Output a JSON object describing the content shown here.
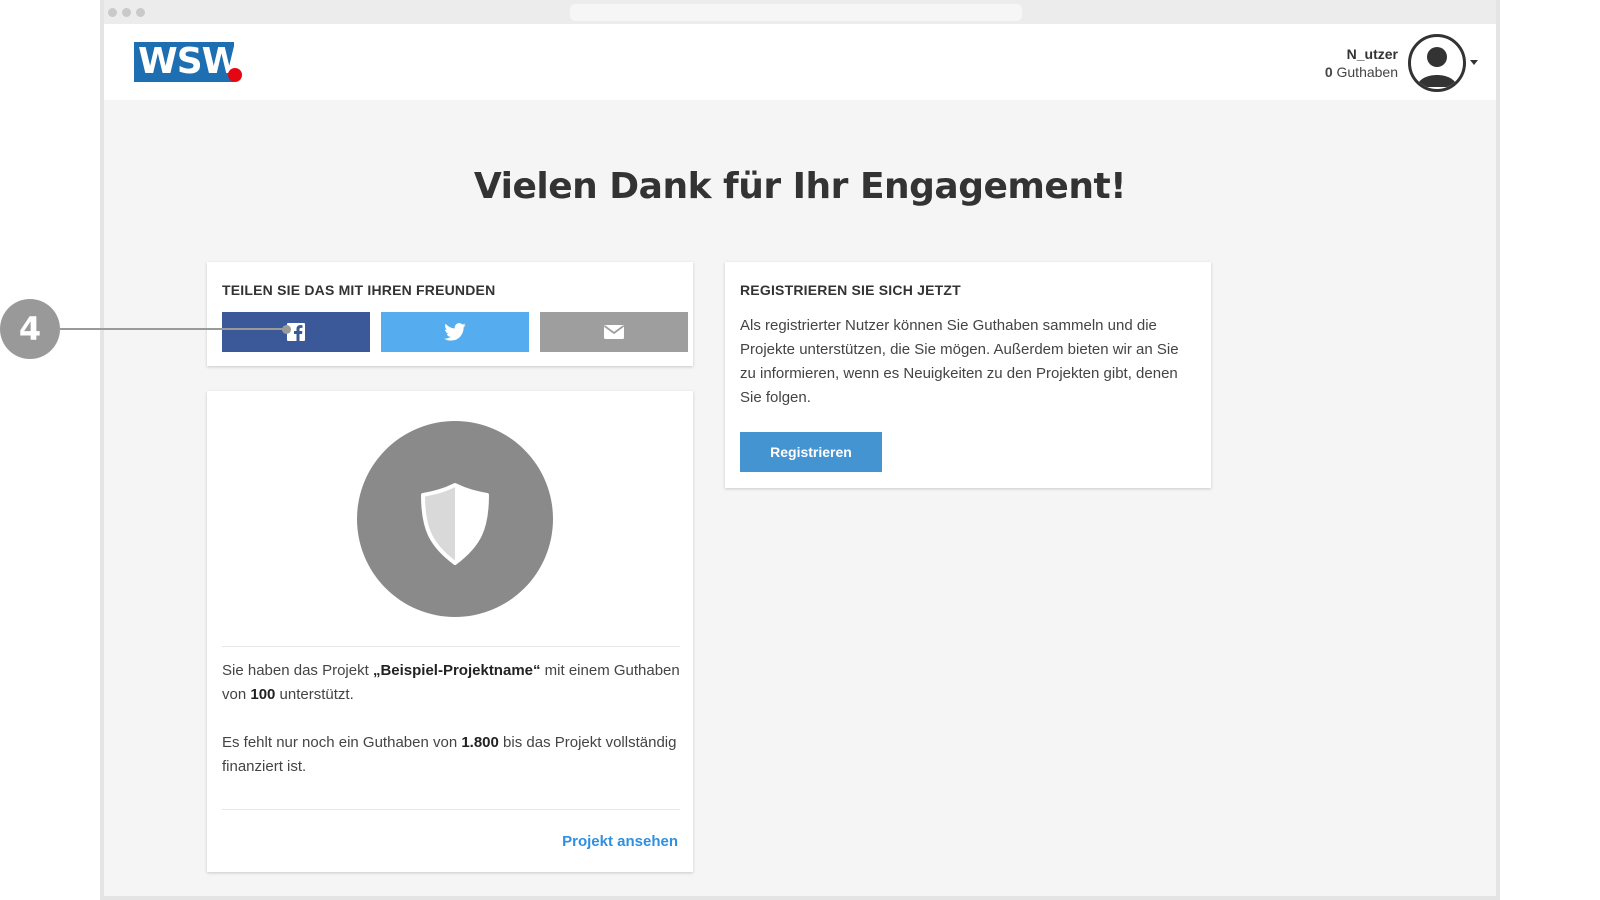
{
  "header": {
    "logo_text": "WSW",
    "user": {
      "name": "N_utzer",
      "credit_amount": "0",
      "credit_label": "Guthaben"
    }
  },
  "main": {
    "title": "Vielen Dank für Ihr Engagement!",
    "share": {
      "heading": "TEILEN SIE DAS MIT IHREN FREUNDEN",
      "buttons": [
        "facebook-icon",
        "twitter-icon",
        "mail-icon"
      ]
    },
    "project": {
      "text1_prefix": "Sie haben das Projekt ",
      "project_name": "„Beispiel-Projektname“",
      "text1_mid": " mit einem Guthaben von ",
      "amount": "100",
      "text1_suffix": " unterstützt.",
      "text2_prefix": "Es fehlt nur noch ein Guthaben von ",
      "missing": "1.800",
      "text2_suffix": " bis das Projekt vollständig finanziert ist.",
      "link": "Projekt ansehen"
    },
    "register": {
      "heading": "REGISTRIEREN SIE SICH JETZT",
      "text": "Als registrierter Nutzer können Sie Guthaben sammeln und die Projekte unterstützen, die Sie mögen. Außerdem bieten wir an Sie zu informieren, wenn es Neuigkeiten zu den Projekten gibt, denen Sie folgen.",
      "button": "Registrieren"
    }
  },
  "callout": {
    "number": "4"
  },
  "colors": {
    "facebook": "#3b5998",
    "twitter": "#55acee",
    "mail": "#9e9e9e",
    "primary": "#4594d2",
    "link": "#2f8fe0",
    "logo_blue": "#1d6fb1",
    "logo_red": "#e30613"
  }
}
